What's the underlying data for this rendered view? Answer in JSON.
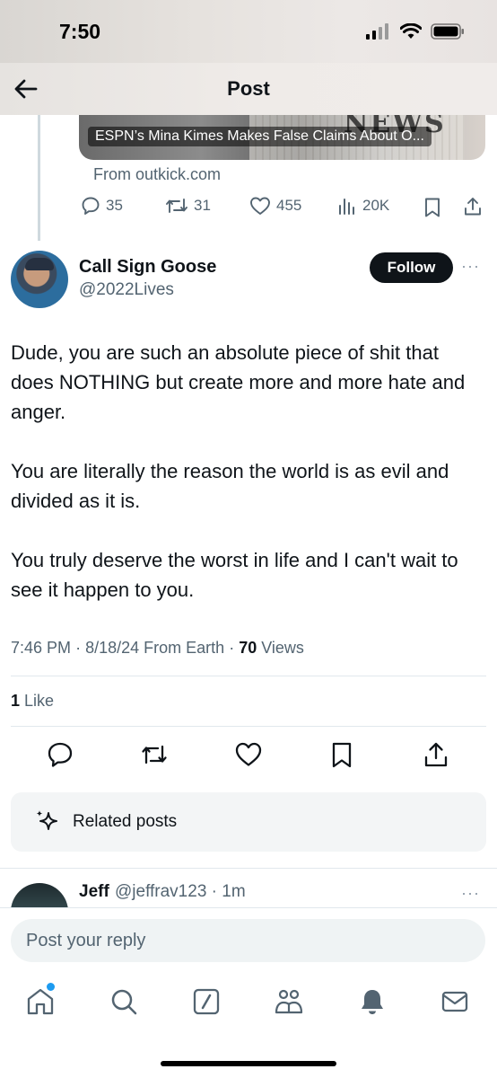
{
  "status_bar": {
    "time": "7:50"
  },
  "nav": {
    "title": "Post",
    "back_icon": "arrow-left-icon"
  },
  "quoted_card": {
    "headline": "ESPN’s Mina Kimes Makes False Claims About O...",
    "masthead": "NEWS",
    "source": "From outkick.com"
  },
  "quoted_stats": {
    "replies": "35",
    "reposts": "31",
    "likes": "455",
    "views": "20K"
  },
  "post": {
    "display_name": "Call Sign Goose",
    "handle": "@2022Lives",
    "follow_label": "Follow",
    "more_label": "···",
    "body": [
      "Dude, you are such an absolute piece of shit that does NOTHING but create more and more hate and anger.",
      "You are literally the reason the world is as evil and divided as it is.",
      "You truly deserve the worst in life and I can't wait to see it happen to you."
    ],
    "time": "7:46 PM",
    "date": "8/18/24",
    "source": "From Earth",
    "views_count": "70",
    "views_label": "Views",
    "likes_count": "1",
    "likes_label": "Like"
  },
  "actions": [
    "reply-icon",
    "repost-icon",
    "like-icon",
    "bookmark-icon",
    "share-icon"
  ],
  "related": {
    "label": "Related posts",
    "icon": "sparkle-icon"
  },
  "reply_preview": {
    "name": "Jeff",
    "handle": "@jeffrav123 · 1m",
    "more_label": "···"
  },
  "composer": {
    "placeholder": "Post your reply"
  },
  "tab_bar": [
    "home-icon",
    "search-icon",
    "grok-icon",
    "communities-icon",
    "notifications-icon",
    "messages-icon"
  ],
  "colors": {
    "accent": "#1d9bf0",
    "text_primary": "#0f1419",
    "text_secondary": "#536471",
    "follow_bg": "#0f1419"
  }
}
